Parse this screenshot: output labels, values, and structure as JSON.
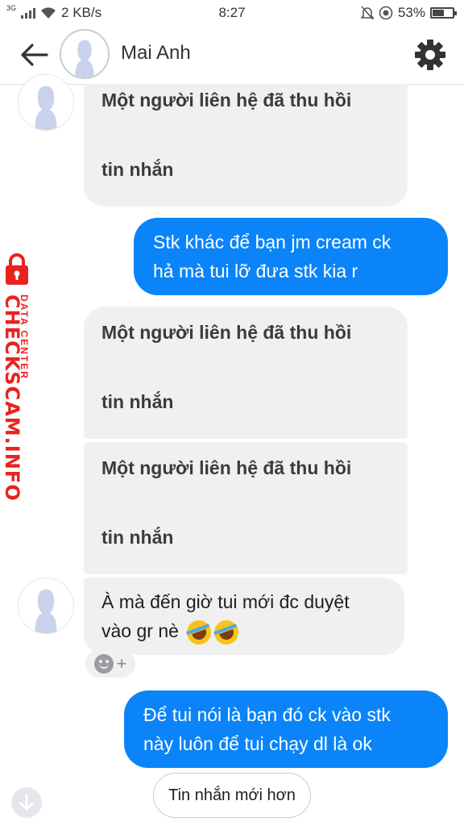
{
  "status_bar": {
    "network": "3G",
    "speed": "2 KB/s",
    "time": "8:27",
    "battery": "53%",
    "battery_level": 0.53
  },
  "header": {
    "contact_name": "Mai Anh"
  },
  "messages": [
    {
      "side": "incoming",
      "type": "recalled",
      "text_line1": "Một người liên hệ đã thu hồi",
      "text_line2": "tin nhắn"
    },
    {
      "side": "outgoing",
      "text_line1": "Stk khác để bạn jm cream ck",
      "text_line2": "hả mà tui lỡ đưa stk kia r"
    },
    {
      "side": "incoming",
      "type": "recalled",
      "text_line1": "Một người liên hệ đã thu hồi",
      "text_line2": "tin nhắn"
    },
    {
      "side": "incoming",
      "type": "recalled",
      "text_line1": "Một người liên hệ đã thu hồi",
      "text_line2": "tin nhắn"
    },
    {
      "side": "incoming",
      "text_line1": "À mà đến giờ tui mới đc duyệt",
      "text_line2": "vào gr nè"
    },
    {
      "side": "outgoing",
      "text_line1": "Để tui nói là bạn đó ck vào stk",
      "text_line2": "này luôn để tui chạy dl là ok"
    }
  ],
  "reaction": {
    "plus": "+"
  },
  "newer_messages_label": "Tin nhắn mới hơn",
  "watermark": {
    "main": "CHECKSCAM.INFO",
    "sub": "DATA CENTER",
    "color": "#e8231f"
  },
  "colors": {
    "outgoing_bubble": "#0a84f8",
    "incoming_bubble": "#f0f0f1"
  }
}
